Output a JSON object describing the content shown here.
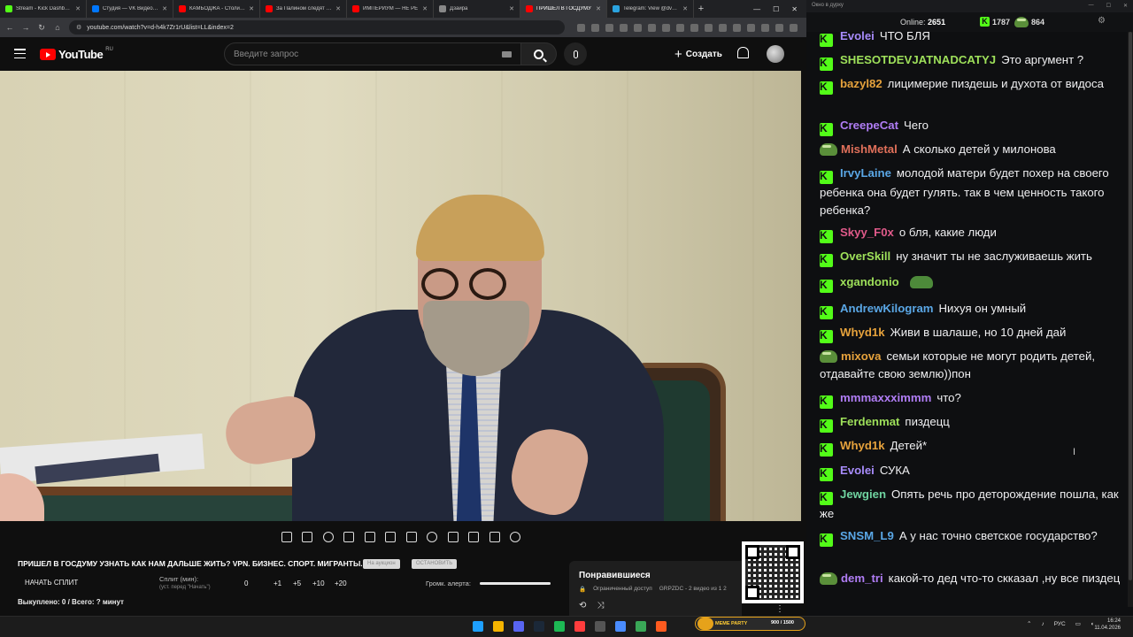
{
  "browser": {
    "tabs": [
      {
        "title": "Stream - Kick Dashboard",
        "color": "#53fc18",
        "active": false
      },
      {
        "title": "Студия — VK Видео Live",
        "color": "#0077ff",
        "active": false
      },
      {
        "title": "КАМБОДЖА - Столица",
        "color": "#ff0000",
        "active": false
      },
      {
        "title": "За Палином следят в д",
        "color": "#ff0000",
        "active": false
      },
      {
        "title": "ИМПЕРИУМ — НЕ РЕ",
        "color": "#ff0000",
        "active": false
      },
      {
        "title": "Дзайра",
        "color": "#888888",
        "active": false
      },
      {
        "title": "ПРИШЕЛ В ГОСДУМУ",
        "color": "#ff0000",
        "active": true
      },
      {
        "title": "Telegram: View @dvach",
        "color": "#2aa3df",
        "active": false
      }
    ],
    "url": "youtube.com/watch?v=d-h4k7Zr1rU&list=LL&index=2"
  },
  "youtube": {
    "logo_text": "YouTube",
    "region": "RU",
    "search_placeholder": "Введите запрос",
    "create_label": "Создать",
    "video_title": "ПРИШЕЛ В ГОСДУМУ УЗНАТЬ КАК НАМ ДАЛЬШЕ ЖИТЬ? VPN. БИЗНЕС. СПОРТ. МИГРАНТЫ.",
    "pill_1": "На аукцион",
    "pill_2": "ОСТАНОВИТЬ",
    "split_button": "НАЧАТЬ СПЛИТ",
    "split_label": "Сплит (мин):",
    "split_sub": "(уст. перед \"Начать\")",
    "split_values": [
      "0",
      "+1",
      "+5",
      "+10",
      "+20"
    ],
    "alert_label": "Громк. алерта:",
    "alert_volume": 1.0,
    "bought_text": "Выкуплено: 0 / Всего: ? минут",
    "playlist": {
      "title": "Понравившиеся",
      "access": "Ограниченный доступ",
      "owner": "GRPZDC - 2 видео из 1 2"
    }
  },
  "chat": {
    "window_title": "Окно в дурку",
    "online_label": "Online:",
    "online_count": "2651",
    "kick_count": "1787",
    "viewer_count": "864",
    "messages": [
      {
        "user": "Evolei",
        "color": "#a78bfa",
        "badge": "kick",
        "text": "ЧТО БЛЯ"
      },
      {
        "user": "SHESOTDEVJATNADCATYJ",
        "color": "#9ee05a",
        "badge": "kick",
        "text": "Это аргумент ?"
      },
      {
        "user": "bazyl82",
        "color": "#e6a23c",
        "badge": "kick",
        "text": "лицимерие пиздешь и духота от видоса"
      },
      {
        "user": "CreepeCat",
        "color": "#b07df5",
        "badge": "kick",
        "text": "Чего"
      },
      {
        "user": "MishMetal",
        "color": "#e0705a",
        "badge": "emote",
        "text": "А сколько детей у милонова"
      },
      {
        "user": "IrvyLaine",
        "color": "#5aa7e6",
        "badge": "kick",
        "text": "молодой матери будет похер на своего ребенка она будет гулять. так в чем ценность такого ребенка?"
      },
      {
        "user": "Skyy_F0x",
        "color": "#e05a8a",
        "badge": "kick",
        "text": "о бля, какие люди"
      },
      {
        "user": "OverSkill",
        "color": "#9ee05a",
        "badge": "kick",
        "text": "ну значит ты не заслуживаешь жить"
      },
      {
        "user": "xgandonio",
        "color": "#9ee05a",
        "badge": "kick",
        "text": ""
      },
      {
        "user": "AndrewKilogram",
        "color": "#5aa7e6",
        "badge": "kick",
        "text": "Нихуя он умный"
      },
      {
        "user": "Whyd1k",
        "color": "#e6a23c",
        "badge": "kick",
        "text": "Живи в шалаше, но 10 дней дай"
      },
      {
        "user": "mixova",
        "color": "#e6a23c",
        "badge": "emote",
        "text": "семьи которые не могут родить детей, отдавайте свою землю))пон"
      },
      {
        "user": "mmmaxxximmm",
        "color": "#b07df5",
        "badge": "kick",
        "text": "что?"
      },
      {
        "user": "Ferdenmat",
        "color": "#9ee05a",
        "badge": "kick",
        "text": "пиздецц"
      },
      {
        "user": "Whyd1k",
        "color": "#e6a23c",
        "badge": "kick",
        "text": "Детей*"
      },
      {
        "user": "Evolei",
        "color": "#a78bfa",
        "badge": "kick",
        "text": "СУКА"
      },
      {
        "user": "Jewgien",
        "color": "#6fd3a0",
        "badge": "kick",
        "text": "Опять речь про деторождение пошла, как же"
      },
      {
        "user": "SNSM_L9",
        "color": "#5aa7e6",
        "badge": "kick",
        "text": "А у нас точно светское государство?"
      },
      {
        "user": "dem_tri",
        "color": "#b07df5",
        "badge": "emote",
        "text": "какой-то дед что-то скказал ,ну все пиздец"
      }
    ]
  },
  "taskbar": {
    "meme_label": "MEME PARTY",
    "meme_count": "900 / 1500",
    "lang": "РУС",
    "time": "16:24",
    "date": "11.04.2026",
    "icon_colors": [
      "#1ea0ff",
      "#f4b400",
      "#5865f2",
      "#1b2838",
      "#1db954",
      "#ff3d3d",
      "#555555",
      "#4a8cff",
      "#3aa757",
      "#ff5b1f"
    ]
  }
}
